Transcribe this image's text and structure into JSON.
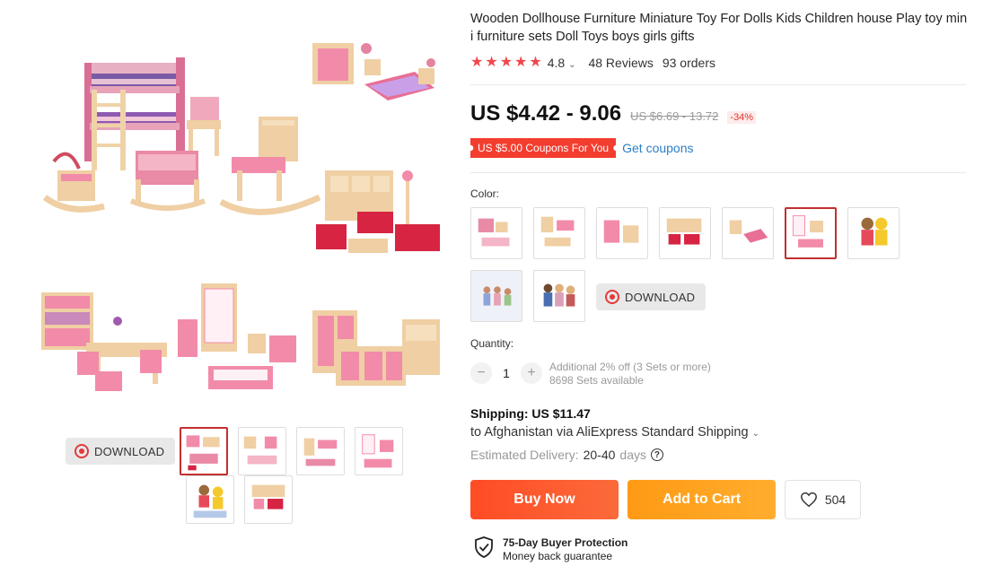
{
  "product": {
    "title": "Wooden Dollhouse Furniture Miniature Toy For Dolls Kids Children house Play toy mini furniture sets Doll Toys boys girls gifts",
    "rating": "4.8",
    "reviews": "48 Reviews",
    "orders": "93 orders",
    "stars": 5
  },
  "price": {
    "current": "US $4.42 - 9.06",
    "original": "US $6.69 - 13.72",
    "discount": "-34%"
  },
  "coupon": {
    "label": "US $5.00 Coupons For You",
    "action": "Get coupons"
  },
  "color": {
    "label": "Color:",
    "selected_index": 5,
    "download_label": "DOWNLOAD"
  },
  "quantity": {
    "label": "Quantity:",
    "value": "1",
    "minus": "−",
    "plus": "+",
    "discount_note": "Additional 2% off (3 Sets or more)",
    "available": "8698 Sets available"
  },
  "shipping": {
    "title": "Shipping: US $11.47",
    "destination": "to Afghanistan via AliExpress Standard Shipping",
    "estimated_label": "Estimated Delivery:",
    "estimated_value": "20-40",
    "estimated_unit": "days",
    "help_symbol": "?"
  },
  "actions": {
    "buy_now": "Buy Now",
    "add_to_cart": "Add to Cart",
    "wishlist_count": "504"
  },
  "protection": {
    "title": "75-Day Buyer Protection",
    "subtitle": "Money back guarantee"
  },
  "gallery": {
    "download_label": "DOWNLOAD",
    "active_thumb": 0
  },
  "colors": {
    "accent_red": "#f0474c",
    "buy_now": "#ff4c25",
    "add_to_cart": "#ff9a14",
    "link": "#2b7fc7",
    "selected_border": "#c23030"
  }
}
